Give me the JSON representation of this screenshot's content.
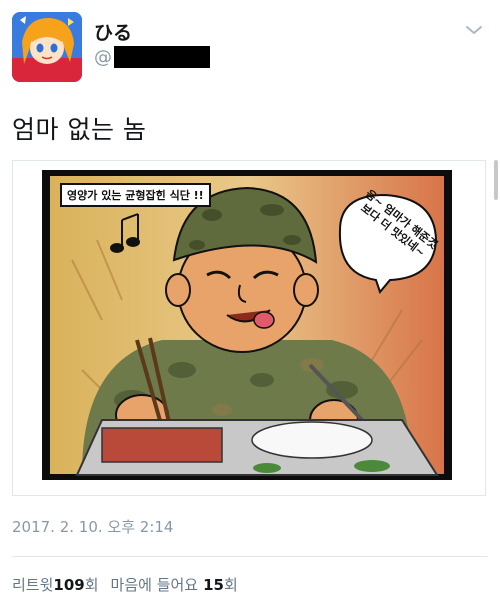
{
  "tweet": {
    "display_name": "ひる",
    "handle_prefix": "@",
    "text": "엄마 없는 놈",
    "timestamp": "2017. 2. 10. 오후 2:14"
  },
  "media": {
    "caption_title": "영양가 있는 균형잡힌 식단 !!",
    "speech_text": "음~ 엄마가 해준것보다 더 맛있네~"
  },
  "stats": {
    "retweet_label": "리트윗",
    "retweet_count": "109",
    "retweet_unit": "회",
    "like_label": "마음에 들어요",
    "like_count": "15",
    "like_unit": "회"
  },
  "icons": {
    "more_menu": "chevron-down-icon"
  },
  "colors": {
    "text_primary": "#14171a",
    "text_secondary": "#8899a6",
    "divider": "#e1e8ed"
  }
}
